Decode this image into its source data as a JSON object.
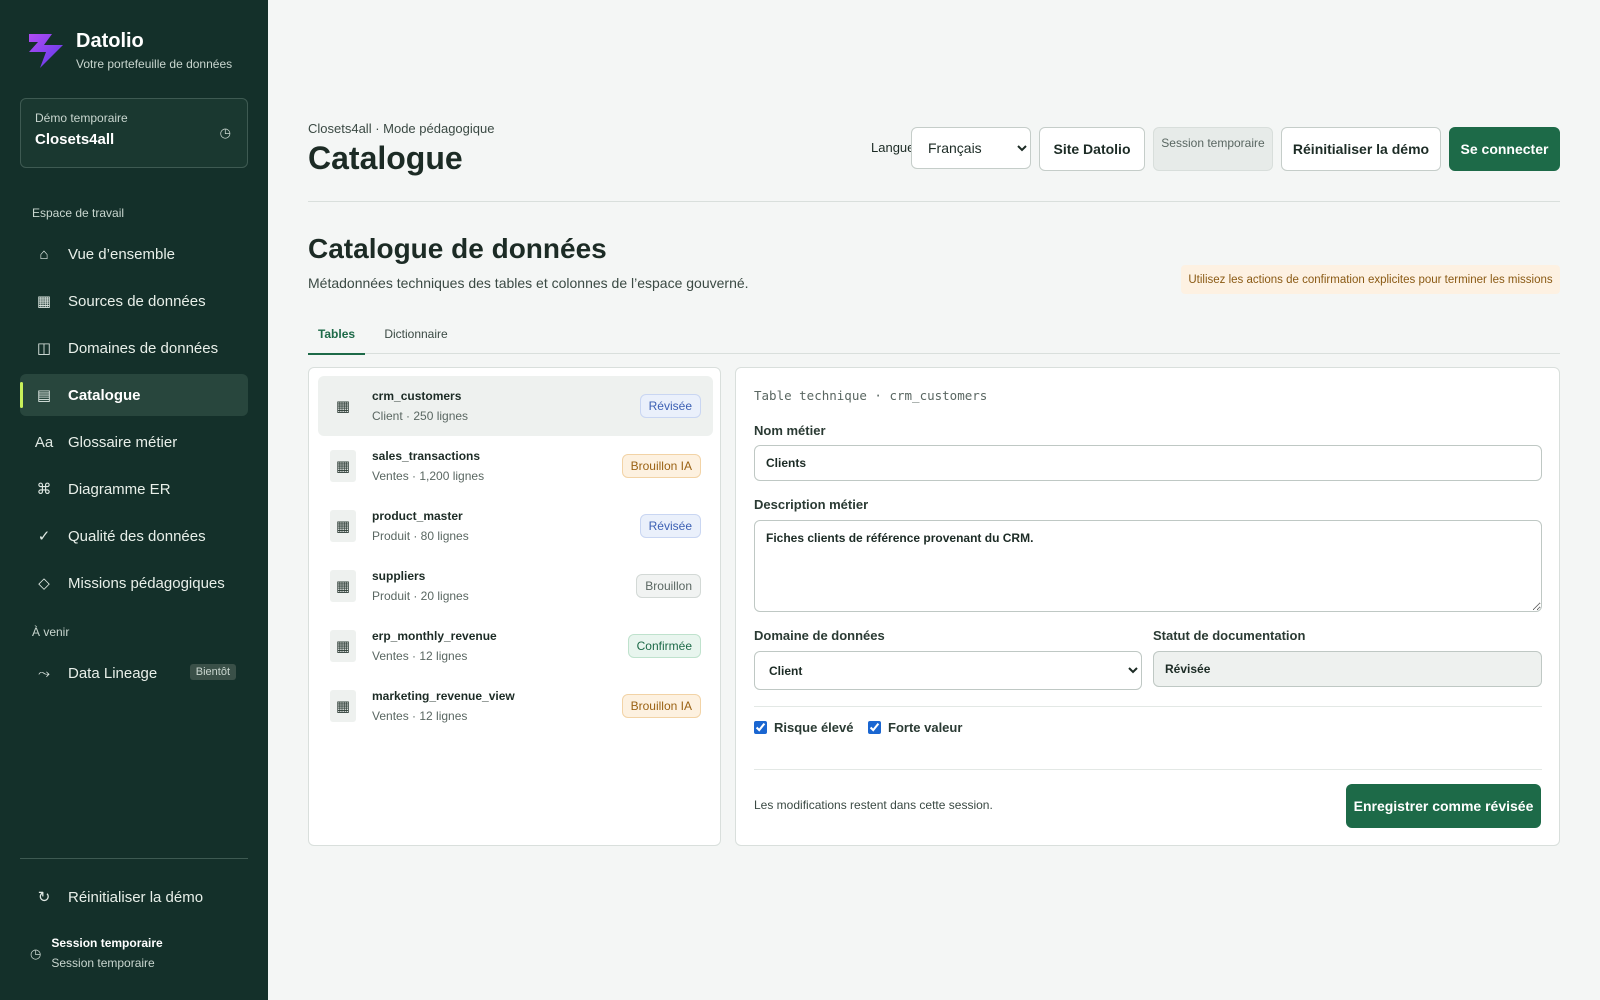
{
  "brand": {
    "name": "Datolio",
    "tagline": "Votre portefeuille de données"
  },
  "demo": {
    "label": "Démo temporaire",
    "name": "Closets4all",
    "icon": "clock-icon"
  },
  "sidebar": {
    "workspace_label": "Espace de travail",
    "items": [
      {
        "label": "Vue d’ensemble",
        "icon": "home-icon",
        "glyph": "⌂"
      },
      {
        "label": "Sources de données",
        "icon": "grid-icon",
        "glyph": "▦"
      },
      {
        "label": "Domaines de données",
        "icon": "columns-icon",
        "glyph": "◫"
      },
      {
        "label": "Catalogue",
        "icon": "list-icon",
        "glyph": "▤",
        "active": true
      },
      {
        "label": "Glossaire métier",
        "icon": "text-icon",
        "glyph": "Aa"
      },
      {
        "label": "Diagramme ER",
        "icon": "command-icon",
        "glyph": "⌘"
      },
      {
        "label": "Qualité des données",
        "icon": "check-icon",
        "glyph": "✓"
      },
      {
        "label": "Missions pédagogiques",
        "icon": "diamond-icon",
        "glyph": "◇"
      }
    ],
    "upcoming_label": "À venir",
    "upcoming": {
      "label": "Data Lineage",
      "icon": "trend-icon",
      "glyph": "⤳",
      "badge": "Bientôt"
    },
    "reset": {
      "label": "Réinitialiser la démo",
      "icon": "refresh-icon",
      "glyph": "↻"
    },
    "session": {
      "title": "Session temporaire",
      "subtitle": "Session temporaire",
      "icon": "clock-icon"
    }
  },
  "header": {
    "breadcrumb": "Closets4all · Mode pédagogique",
    "title": "Catalogue",
    "language_label": "Langue",
    "language_value": "Français",
    "site_button": "Site Datolio",
    "session_chip": "Session temporaire",
    "reset_button": "Réinitialiser la démo",
    "login_button": "Se connecter"
  },
  "section": {
    "title": "Catalogue de données",
    "description": "Métadonnées techniques des tables et colonnes de l’espace gouverné.",
    "hint": "Utilisez les actions de confirmation explicites pour terminer les missions"
  },
  "tabs": [
    {
      "label": "Tables",
      "active": true
    },
    {
      "label": "Dictionnaire",
      "active": false
    }
  ],
  "tables": [
    {
      "name": "crm_customers",
      "meta": "Client · 250 lignes",
      "status": "Révisée",
      "status_color": "#3b5fb3",
      "status_bg": "#eaf0fb",
      "status_border": "#c9d6f2",
      "selected": true
    },
    {
      "name": "sales_transactions",
      "meta": "Ventes · 1,200 lignes",
      "status": "Brouillon IA",
      "status_color": "#9a6214",
      "status_bg": "#fdf1e0",
      "status_border": "#f2d3a6"
    },
    {
      "name": "product_master",
      "meta": "Produit · 80 lignes",
      "status": "Révisée",
      "status_color": "#3b5fb3",
      "status_bg": "#eaf0fb",
      "status_border": "#c9d6f2"
    },
    {
      "name": "suppliers",
      "meta": "Produit · 20 lignes",
      "status": "Brouillon",
      "status_color": "#5a6762",
      "status_bg": "#f1f3f2",
      "status_border": "#d3d9d6"
    },
    {
      "name": "erp_monthly_revenue",
      "meta": "Ventes · 12 lignes",
      "status": "Confirmée",
      "status_color": "#1d6a48",
      "status_bg": "#e8f5ee",
      "status_border": "#bfe2cd"
    },
    {
      "name": "marketing_revenue_view",
      "meta": "Ventes · 12 lignes",
      "status": "Brouillon IA",
      "status_color": "#9a6214",
      "status_bg": "#fdf1e0",
      "status_border": "#f2d3a6"
    }
  ],
  "detail": {
    "technical_label": "Table technique · crm_customers",
    "business_name_label": "Nom métier",
    "business_name_value": "Clients",
    "description_label": "Description métier",
    "description_value": "Fiches clients de référence provenant du CRM.",
    "domain_label": "Domaine de données",
    "domain_value": "Client",
    "status_label": "Statut de documentation",
    "status_value": "Révisée",
    "high_risk_label": "Risque élevé",
    "high_value_label": "Forte valeur",
    "footnote": "Les modifications restent dans cette session.",
    "save_button": "Enregistrer comme révisée"
  },
  "colors": {
    "sidebar_bg": "#14302a",
    "primary": "#1d6a48",
    "accent": "#c8f05a"
  }
}
